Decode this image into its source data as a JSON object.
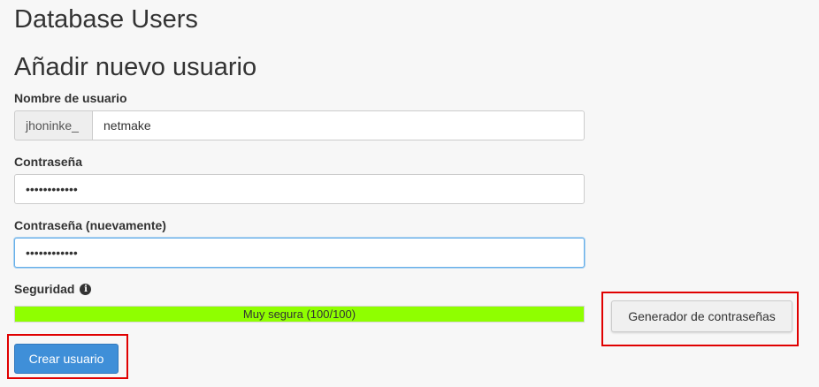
{
  "page": {
    "title": "Database Users",
    "section_title": "Añadir nuevo usuario"
  },
  "username": {
    "label": "Nombre de usuario",
    "prefix": "jhoninke_",
    "value": "netmake"
  },
  "password": {
    "label": "Contraseña",
    "value": "••••••••••••"
  },
  "password_again": {
    "label": "Contraseña (nuevamente)",
    "value": "••••••••••••"
  },
  "security": {
    "label": "Seguridad",
    "icon": "info-icon",
    "strength_text": "Muy segura (100/100)",
    "strength_percent": 100,
    "bar_color": "#8fff00"
  },
  "buttons": {
    "generator_label": "Generador de contraseñas",
    "create_label": "Crear usuario"
  },
  "colors": {
    "primary": "#3f8fd8",
    "highlight": "#e00000"
  }
}
